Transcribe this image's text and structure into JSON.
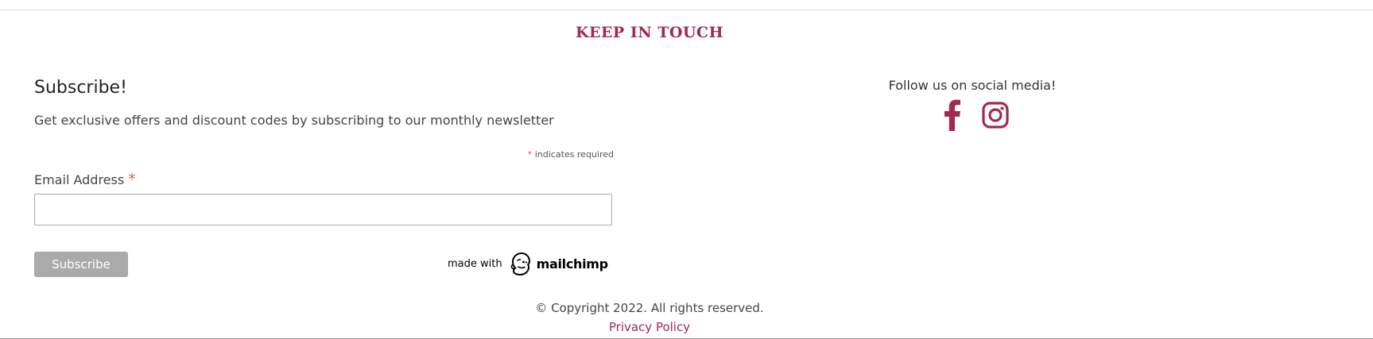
{
  "section": {
    "title": "KEEP IN TOUCH"
  },
  "subscribe": {
    "heading": "Subscribe!",
    "description": "Get exclusive offers and discount codes by subscribing to our monthly newsletter",
    "required_star": "*",
    "required_note": "indicates required",
    "email_label": "Email Address",
    "email_value": "",
    "email_placeholder": "",
    "button_label": "Subscribe",
    "made_with": "made with",
    "mailchimp_word": "mailchimp"
  },
  "social": {
    "title": "Follow us on social media!",
    "icons": [
      "facebook-icon",
      "instagram-icon"
    ]
  },
  "footer": {
    "copyright": "© Copyright 2022. All rights reserved.",
    "privacy_link": "Privacy Policy"
  },
  "colors": {
    "accent": "#a12a4d",
    "required_star": "#e85c41",
    "button_bg": "#aaaaaa"
  }
}
